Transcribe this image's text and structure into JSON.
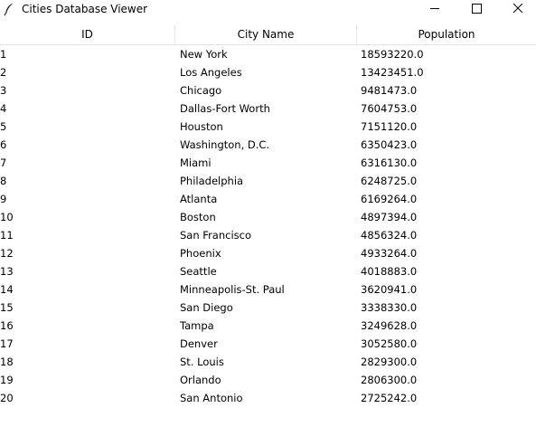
{
  "window": {
    "title": "Cities Database Viewer"
  },
  "table": {
    "columns": [
      "ID",
      "City Name",
      "Population"
    ],
    "rows": [
      {
        "id": "1",
        "name": "New York",
        "population": "18593220.0"
      },
      {
        "id": "2",
        "name": "Los Angeles",
        "population": "13423451.0"
      },
      {
        "id": "3",
        "name": "Chicago",
        "population": "9481473.0"
      },
      {
        "id": "4",
        "name": "Dallas-Fort Worth",
        "population": "7604753.0"
      },
      {
        "id": "5",
        "name": "Houston",
        "population": "7151120.0"
      },
      {
        "id": "6",
        "name": "Washington, D.C.",
        "population": "6350423.0"
      },
      {
        "id": "7",
        "name": "Miami",
        "population": "6316130.0"
      },
      {
        "id": "8",
        "name": "Philadelphia",
        "population": "6248725.0"
      },
      {
        "id": "9",
        "name": "Atlanta",
        "population": "6169264.0"
      },
      {
        "id": "10",
        "name": "Boston",
        "population": "4897394.0"
      },
      {
        "id": "11",
        "name": "San Francisco",
        "population": "4856324.0"
      },
      {
        "id": "12",
        "name": "Phoenix",
        "population": "4933264.0"
      },
      {
        "id": "13",
        "name": "Seattle",
        "population": "4018883.0"
      },
      {
        "id": "14",
        "name": "Minneapolis-St. Paul",
        "population": "3620941.0"
      },
      {
        "id": "15",
        "name": "San Diego",
        "population": "3338330.0"
      },
      {
        "id": "16",
        "name": "Tampa",
        "population": "3249628.0"
      },
      {
        "id": "17",
        "name": "Denver",
        "population": "3052580.0"
      },
      {
        "id": "18",
        "name": "St. Louis",
        "population": "2829300.0"
      },
      {
        "id": "19",
        "name": "Orlando",
        "population": "2806300.0"
      },
      {
        "id": "20",
        "name": "San Antonio",
        "population": "2725242.0"
      }
    ]
  }
}
